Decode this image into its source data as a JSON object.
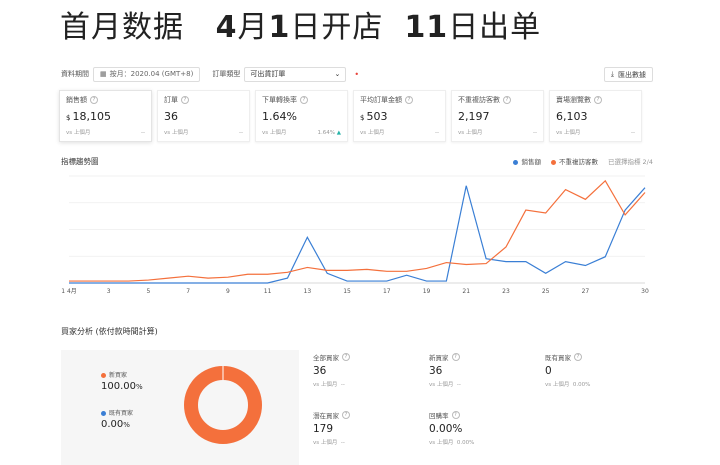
{
  "headline": {
    "part1": "首月数据",
    "part2a": "4",
    "part2b": "月",
    "part2c": "1",
    "part2d": "日开店",
    "part3a": "11",
    "part3b": "日出单"
  },
  "filter": {
    "period_label": "資料期間",
    "date_value": "按月：2020.04 (GMT+8)",
    "order_type_label": "訂單類型",
    "order_type_value": "可出貨訂單",
    "export_label": "匯出數據"
  },
  "metrics": [
    {
      "label": "銷售額",
      "currency": "$",
      "value": "18,105",
      "cmp": "vs 上個月",
      "delta": "--"
    },
    {
      "label": "訂單",
      "currency": "",
      "value": "36",
      "cmp": "vs 上個月",
      "delta": "--"
    },
    {
      "label": "下單轉換率",
      "currency": "",
      "value": "1.64%",
      "cmp": "vs 上個月",
      "delta": "1.64%"
    },
    {
      "label": "平均訂單金額",
      "currency": "$",
      "value": "503",
      "cmp": "vs 上個月",
      "delta": "--"
    },
    {
      "label": "不重複訪客數",
      "currency": "",
      "value": "2,197",
      "cmp": "vs 上個月",
      "delta": "--"
    },
    {
      "label": "賣場瀏覽數",
      "currency": "",
      "value": "6,103",
      "cmp": "vs 上個月",
      "delta": "--"
    }
  ],
  "trend": {
    "title": "指標趨勢圖",
    "legend_selected": "已選擇指標 2/4"
  },
  "chart_data": {
    "type": "line",
    "x": [
      1,
      2,
      3,
      4,
      5,
      6,
      7,
      8,
      9,
      10,
      11,
      12,
      13,
      14,
      15,
      16,
      17,
      18,
      19,
      20,
      21,
      22,
      23,
      24,
      25,
      26,
      27,
      28,
      29,
      30
    ],
    "x_tick_labels": [
      "1 4月",
      "3",
      "5",
      "7",
      "9",
      "11",
      "13",
      "15",
      "17",
      "19",
      "21",
      "23",
      "25",
      "27",
      "29"
    ],
    "x_tick_positions": [
      1,
      3,
      5,
      7,
      9,
      11,
      13,
      15,
      17,
      19,
      21,
      23,
      25,
      27,
      30
    ],
    "x_tick_texts": [
      "1 4月",
      "3",
      "5",
      "7",
      "9",
      "11",
      "13",
      "15",
      "17",
      "19",
      "21",
      "23",
      "25",
      "27",
      "30"
    ],
    "grid": true,
    "series": [
      {
        "name": "銷售額",
        "color": "#3a7fd5",
        "values": [
          0,
          0,
          0,
          0,
          0,
          0,
          0,
          0,
          0,
          0,
          0,
          5,
          47,
          10,
          2,
          2,
          2,
          8,
          2,
          2,
          100,
          25,
          22,
          22,
          10,
          22,
          18,
          27,
          75,
          98
        ]
      },
      {
        "name": "不重複訪客數",
        "color": "#f4703c",
        "values": [
          2,
          2,
          2,
          2,
          3,
          5,
          7,
          5,
          6,
          9,
          9,
          11,
          16,
          13,
          13,
          14,
          12,
          12,
          15,
          21,
          19,
          20,
          37,
          75,
          72,
          96,
          86,
          105,
          70,
          93
        ]
      }
    ],
    "ylim": [
      0,
      110
    ]
  },
  "buyer": {
    "title": "買家分析 (依付款時間計算)",
    "new_label": "新買家",
    "new_pct": "100.00",
    "new_pct_unit": "%",
    "old_label": "既有買家",
    "old_pct": "0.00",
    "old_pct_unit": "%",
    "new_color": "#f4703c",
    "old_color": "#3a7fd5",
    "stats": [
      {
        "label": "全部買家",
        "value": "36",
        "cmp": "vs 上個月",
        "delta": "--"
      },
      {
        "label": "新買家",
        "value": "36",
        "cmp": "vs 上個月",
        "delta": "--"
      },
      {
        "label": "既有買家",
        "value": "0",
        "cmp": "vs 上個月",
        "delta": "0.00%"
      },
      {
        "label": "潛在買家",
        "value": "179",
        "cmp": "vs 上個月",
        "delta": "--"
      },
      {
        "label": "回購率",
        "value": "0.00%",
        "cmp": "vs 上個月",
        "delta": "0.00%"
      }
    ]
  }
}
